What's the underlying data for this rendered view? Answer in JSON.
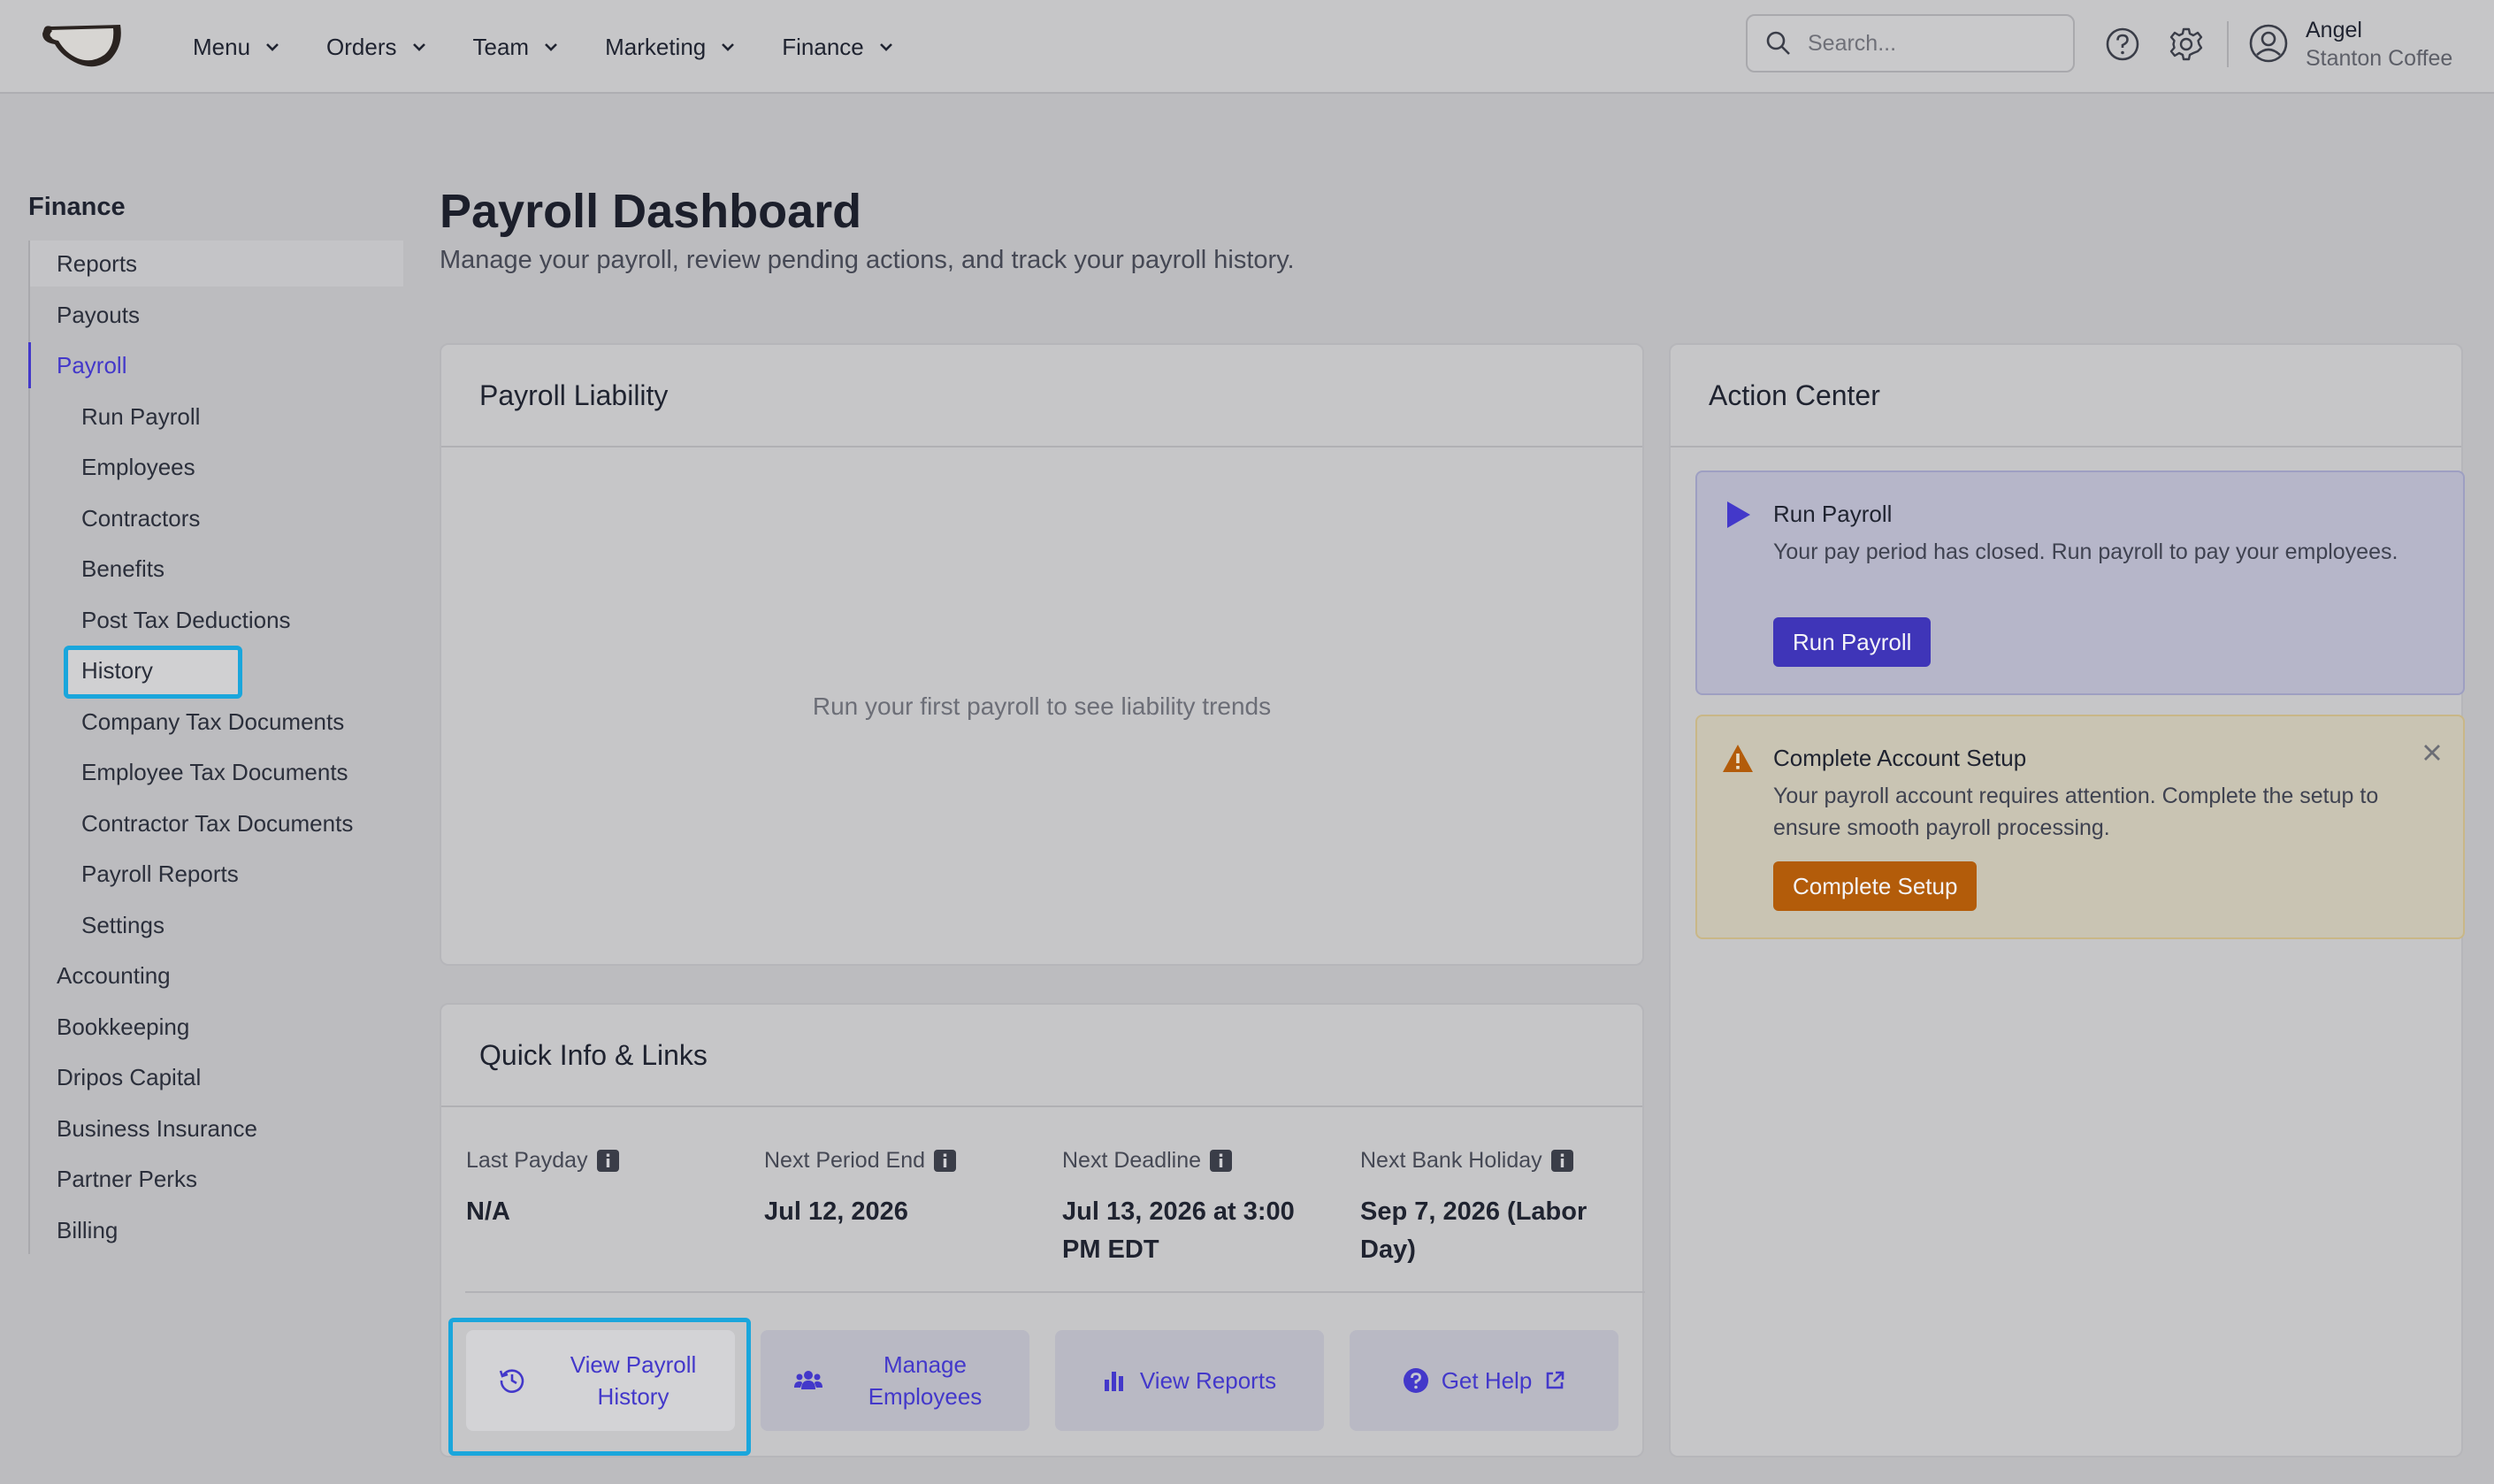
{
  "brand": {
    "logo_icon": "coffee-cup-logo"
  },
  "nav": {
    "items": [
      {
        "label": "Menu"
      },
      {
        "label": "Orders"
      },
      {
        "label": "Team"
      },
      {
        "label": "Marketing"
      },
      {
        "label": "Finance"
      }
    ]
  },
  "search": {
    "placeholder": "Search..."
  },
  "user": {
    "name": "Angel",
    "company": "Stanton Coffee"
  },
  "sidebar": {
    "title": "Finance",
    "items": [
      {
        "label": "Reports"
      },
      {
        "label": "Payouts"
      },
      {
        "label": "Payroll"
      },
      {
        "label": "Run Payroll"
      },
      {
        "label": "Employees"
      },
      {
        "label": "Contractors"
      },
      {
        "label": "Benefits"
      },
      {
        "label": "Post Tax Deductions"
      },
      {
        "label": "History"
      },
      {
        "label": "Company Tax Documents"
      },
      {
        "label": "Employee Tax Documents"
      },
      {
        "label": "Contractor Tax Documents"
      },
      {
        "label": "Payroll Reports"
      },
      {
        "label": "Settings"
      },
      {
        "label": "Accounting"
      },
      {
        "label": "Bookkeeping"
      },
      {
        "label": "Dripos Capital"
      },
      {
        "label": "Business Insurance"
      },
      {
        "label": "Partner Perks"
      },
      {
        "label": "Billing"
      }
    ]
  },
  "page": {
    "title": "Payroll Dashboard",
    "subtitle": "Manage your payroll, review pending actions, and track your payroll history."
  },
  "liability": {
    "title": "Payroll Liability",
    "empty": "Run your first payroll to see liability trends"
  },
  "quick_info": {
    "title": "Quick Info & Links",
    "items": [
      {
        "label": "Last Payday",
        "value": "N/A"
      },
      {
        "label": "Next Period End",
        "value": "Jul 12, 2026"
      },
      {
        "label": "Next Deadline",
        "value": "Jul 13, 2026 at 3:00 PM EDT"
      },
      {
        "label": "Next Bank Holiday",
        "value": "Sep 7, 2026 (Labor Day)"
      }
    ],
    "links": [
      {
        "label": "View Payroll History",
        "icon": "history-icon"
      },
      {
        "label": "Manage Employees",
        "icon": "users-icon"
      },
      {
        "label": "View Reports",
        "icon": "bar-chart-icon"
      },
      {
        "label": "Get Help",
        "icon": "help-icon"
      }
    ]
  },
  "action_center": {
    "title": "Action Center",
    "run_payroll": {
      "title": "Run Payroll",
      "text": "Your pay period has closed. Run payroll to pay your employees.",
      "button": "Run Payroll"
    },
    "account_setup": {
      "title": "Complete Account Setup",
      "text": "Your payroll account requires attention. Complete the setup to ensure smooth payroll processing.",
      "button": "Complete Setup"
    }
  },
  "colors": {
    "accent": "#4338ca",
    "focus_ring": "#1aa6dc",
    "warning": "#b35c0a"
  }
}
